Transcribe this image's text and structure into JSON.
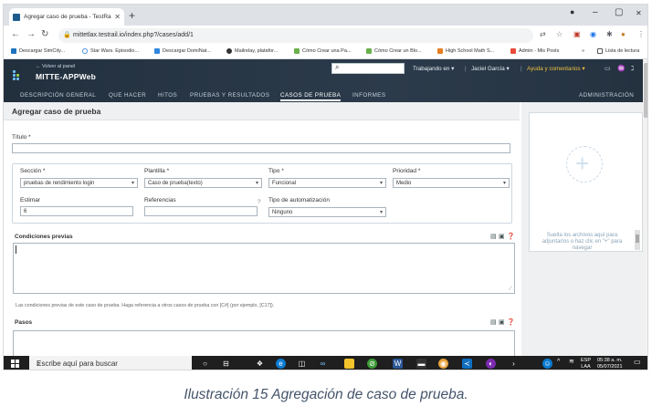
{
  "browser": {
    "tab_title": "Agregar caso de prueba - TestRail",
    "tab_close": "✕",
    "new_tab": "+",
    "url": "mittetlax.testrail.io/index.php?/cases/add/1",
    "win_min": "–",
    "win_max": "▢",
    "win_close": "✕",
    "bookmarks": [
      "Descargar SimCity...",
      "Star Wars. Episodio...",
      "Descargar DomiNat...",
      "Mailrelay, platafor...",
      "Cómo Crear una Pa...",
      "Cómo Crear un Blo...",
      "High School Math S...",
      "Admin - Mis Posts"
    ],
    "bookmarks_more": "»",
    "reading_list": "Lista de lectura"
  },
  "app": {
    "back_link": "← Volver al panel",
    "project_name": "MITTE-APPWeb",
    "working_in": "Trabajando en ▾",
    "user": "Jaciel García ▾",
    "help": "Ayuda y comentarios ▾",
    "nav": [
      "DESCRIPCIÓN GENERAL",
      "QUE HACER",
      "HITOS",
      "PRUEBAS Y RESULTADOS",
      "CASOS DE PRUEBA",
      "INFORMES"
    ],
    "admin": "ADMINISTRACIÓN"
  },
  "form": {
    "page_title": "Agregar caso de prueba",
    "title_label": "Título *",
    "title_value": "",
    "section_label": "Sección *",
    "section_value": "pruebas de rendimiento login",
    "template_label": "Plantilla *",
    "template_value": "Caso de prueba(texto)",
    "type_label": "Tipo *",
    "type_value": "Funcional",
    "priority_label": "Prioridad *",
    "priority_value": "Medio",
    "estimate_label": "Estimar",
    "estimate_value": "6",
    "references_label": "Referencias",
    "references_value": "",
    "references_hint": "?",
    "automation_label": "Tipo de automatización",
    "automation_value": "Ninguno",
    "preconditions_label": "Condiciones previas",
    "preconditions_help": "Las condiciones previas de este caso de prueba. Haga referencia a otros casos de prueba con [C#] (por ejemplo, [C17]).",
    "steps_label": "Pasos"
  },
  "sidebar": {
    "drop_text": "Suelta los archivos aquí para adjuntarlos o haz clic en \"+\" para navegar"
  },
  "taskbar": {
    "search_placeholder": "Escribe aquí para buscar",
    "lang_top": "ESP",
    "lang_bottom": "LAA",
    "time": "05:38 a. m.",
    "date": "05/07/2021"
  },
  "caption": "Ilustración 15 Agregación de caso de prueba."
}
